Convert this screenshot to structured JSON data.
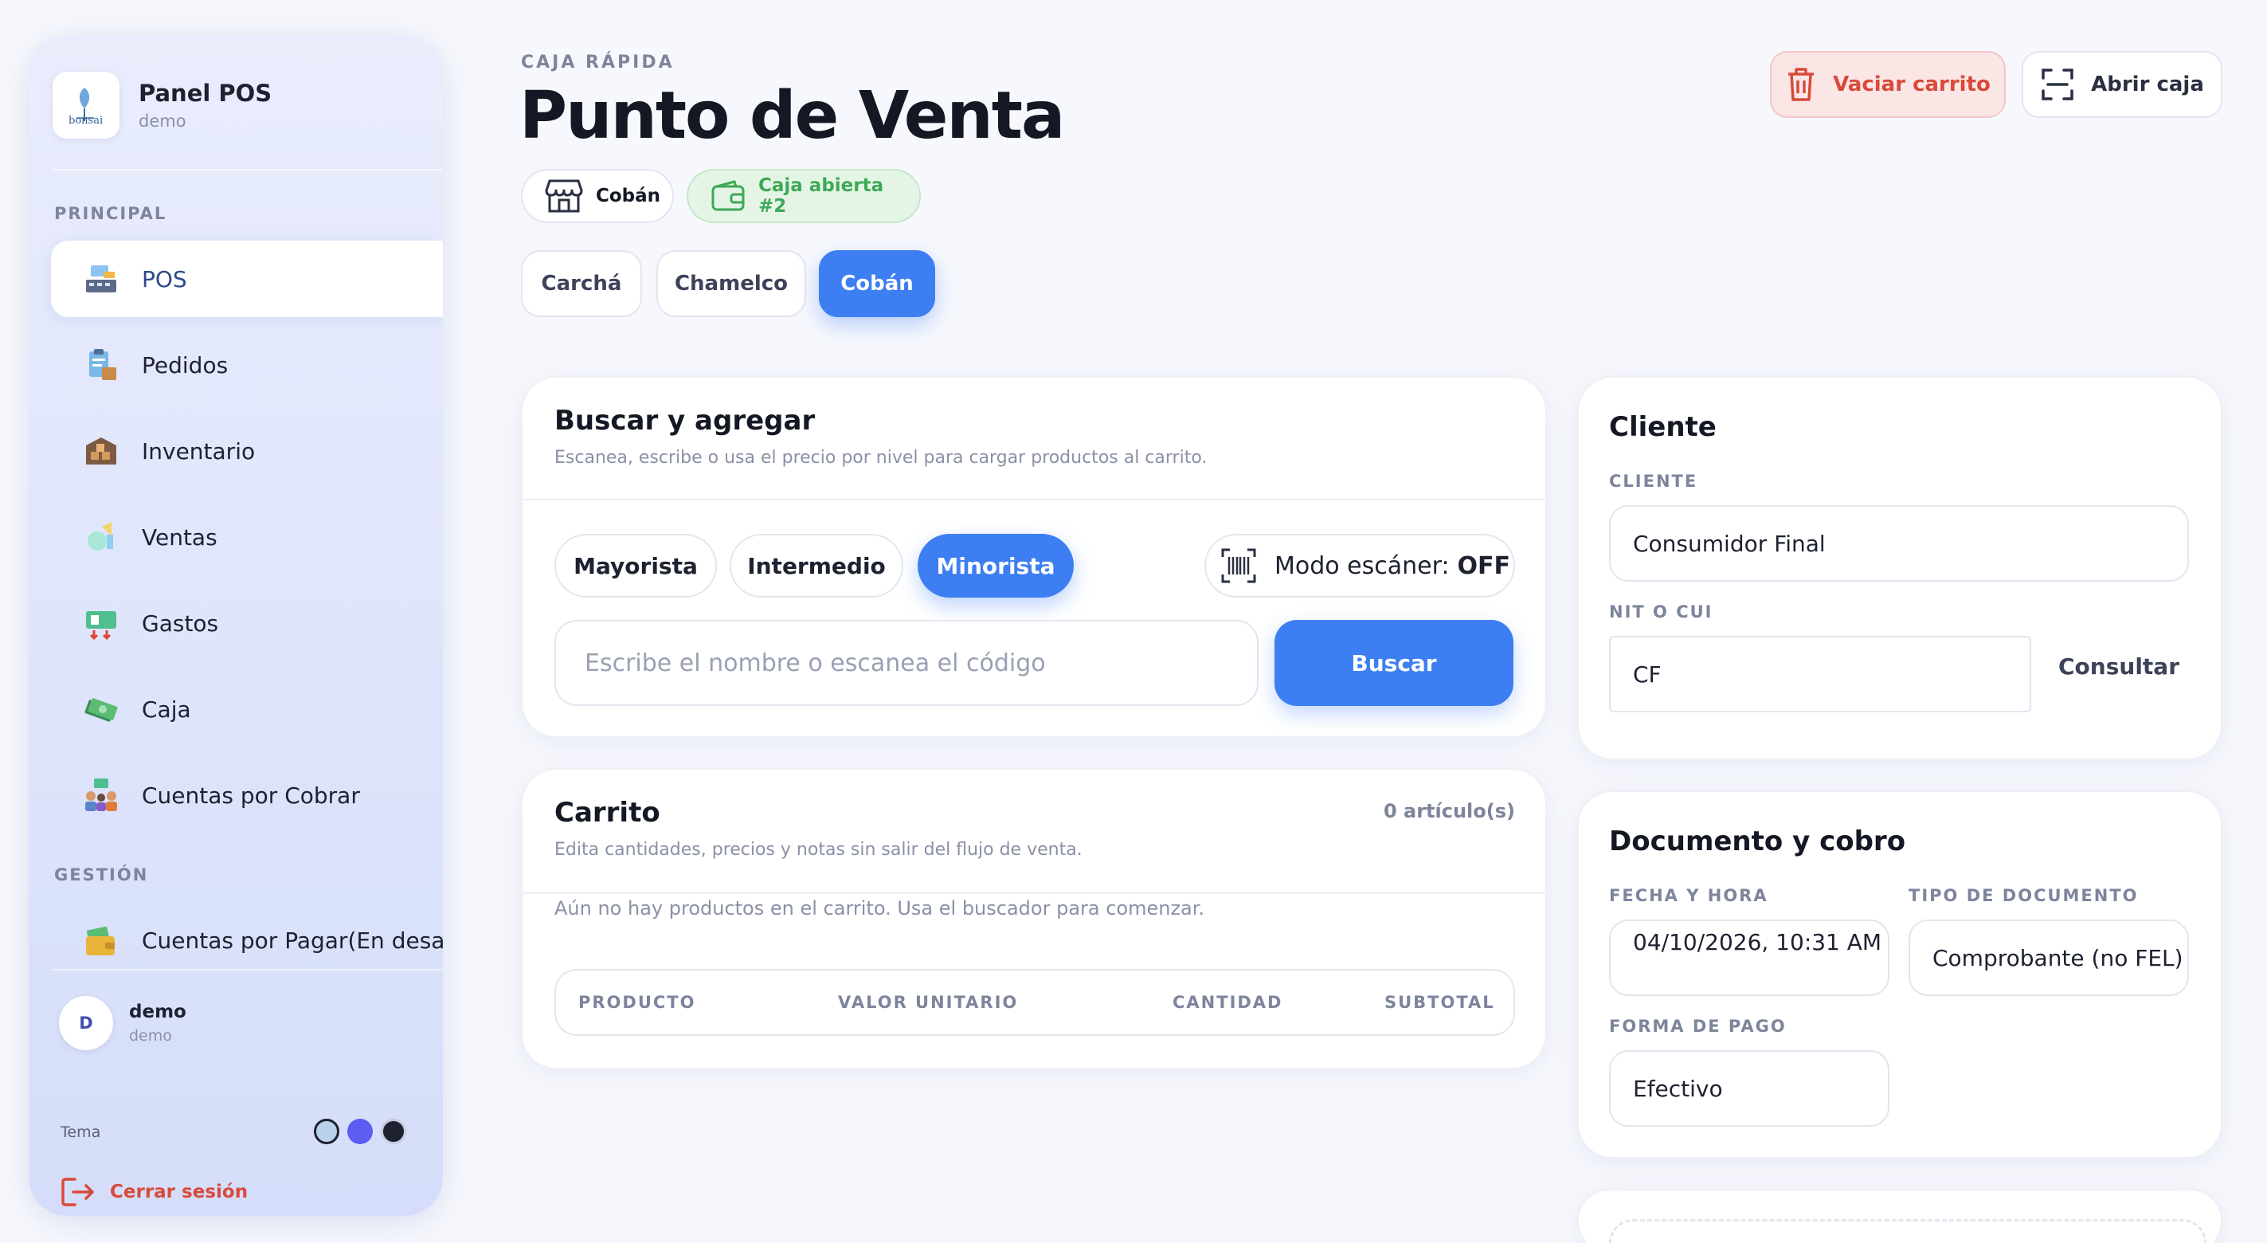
{
  "sidebar": {
    "brand": {
      "title": "Panel POS",
      "subtitle": "demo",
      "logo_text": "bonsai"
    },
    "sections": {
      "principal": "PRINCIPAL",
      "gestion": "GESTIÓN"
    },
    "items": [
      {
        "label": "POS",
        "icon": "pos-register-icon",
        "active": true
      },
      {
        "label": "Pedidos",
        "icon": "clipboard-box-icon",
        "active": false
      },
      {
        "label": "Inventario",
        "icon": "warehouse-boxes-icon",
        "active": false
      },
      {
        "label": "Ventas",
        "icon": "sales-chart-icon",
        "active": false
      },
      {
        "label": "Gastos",
        "icon": "expenses-icon",
        "active": false
      },
      {
        "label": "Caja",
        "icon": "cash-bills-icon",
        "active": false
      },
      {
        "label": "Cuentas por Cobrar",
        "icon": "receivables-people-icon",
        "active": false
      },
      {
        "label": "Cuentas por Pagar(En desarro",
        "icon": "payables-wallet-icon",
        "active": false
      }
    ],
    "user": {
      "initial": "D",
      "name": "demo",
      "subtitle": "demo"
    },
    "theme": {
      "label": "Tema",
      "swatches": [
        "#b9d2ea",
        "#5b5ef0",
        "#1e2130"
      ]
    },
    "logout_label": "Cerrar sesión"
  },
  "header": {
    "eyebrow": "CAJA RÁPIDA",
    "title": "Punto de Venta",
    "store_chip": "Cobán",
    "register_chip": "Caja abierta #2",
    "clear_cart_label": "Vaciar carrito",
    "open_register_label": "Abrir caja",
    "branches": [
      "Carchá",
      "Chamelco",
      "Cobán"
    ],
    "active_branch": "Cobán"
  },
  "search_card": {
    "title": "Buscar y agregar",
    "subtitle": "Escanea, escribe o usa el precio por nivel para cargar productos al carrito.",
    "price_levels": [
      "Mayorista",
      "Intermedio",
      "Minorista"
    ],
    "active_level": "Minorista",
    "scanner_label": "Modo escáner:",
    "scanner_state": "OFF",
    "search_placeholder": "Escribe el nombre o escanea el código",
    "search_value": "",
    "search_button": "Buscar"
  },
  "cart_card": {
    "title": "Carrito",
    "subtitle": "Edita cantidades, precios y notas sin salir del flujo de venta.",
    "count": "0 artículo(s)",
    "empty_message": "Aún no hay productos en el carrito. Usa el buscador para comenzar.",
    "columns": [
      "PRODUCTO",
      "VALOR UNITARIO",
      "CANTIDAD",
      "SUBTOTAL"
    ]
  },
  "client_card": {
    "title": "Cliente",
    "client_label": "CLIENTE",
    "client_value": "Consumidor Final",
    "nit_label": "NIT O CUI",
    "nit_value": "CF",
    "consult_button": "Consultar"
  },
  "document_card": {
    "title": "Documento y cobro",
    "datetime_label": "FECHA Y HORA",
    "datetime_value": "04/10/2026, 10:31 AM",
    "doc_type_label": "TIPO DE DOCUMENTO",
    "doc_type_value": "Comprobante (no FEL)",
    "payment_label": "FORMA DE PAGO",
    "payment_value": "Efectivo"
  },
  "colors": {
    "accent": "#3d7ff2",
    "danger": "#d84a3a",
    "success": "#3ea856"
  }
}
